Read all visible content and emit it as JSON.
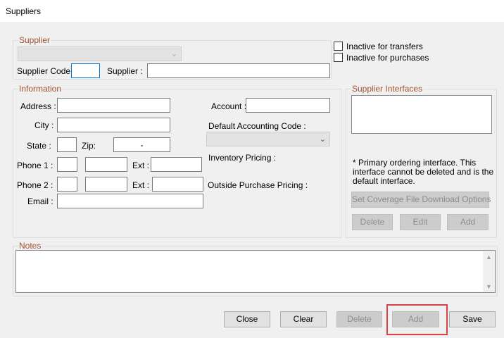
{
  "window": {
    "title": "Suppliers"
  },
  "supplier_group": {
    "title": "Supplier",
    "supplier_code_label": "Supplier Code :",
    "supplier_code_value": "",
    "supplier_label": "Supplier :",
    "supplier_value": ""
  },
  "flags": {
    "inactive_transfers_label": "Inactive for transfers",
    "inactive_purchases_label": "Inactive for purchases"
  },
  "information": {
    "title": "Information",
    "address_label": "Address :",
    "city_label": "City :",
    "state_label": "State :",
    "zip_label": "Zip:",
    "zip_value": "-",
    "phone1_label": "Phone 1 :",
    "phone2_label": "Phone 2 :",
    "ext_label": "Ext :",
    "email_label": "Email :",
    "account_label": "Account :",
    "default_accounting_code_label": "Default Accounting Code :",
    "inventory_pricing_label": "Inventory Pricing :",
    "outside_purchase_pricing_label": "Outside Purchase Pricing :"
  },
  "interfaces": {
    "title": "Supplier Interfaces",
    "note_line1": "* Primary ordering interface.  This",
    "note_line2": "interface cannot be deleted and is the",
    "note_line3": "default interface.",
    "coverage_button": "Set Coverage File Download Options",
    "delete_button": "Delete",
    "edit_button": "Edit",
    "add_button": "Add"
  },
  "notes": {
    "title": "Notes",
    "value": ""
  },
  "footer": {
    "close": "Close",
    "clear": "Clear",
    "delete": "Delete",
    "add": "Add",
    "save": "Save"
  },
  "colors": {
    "group_title": "#a0522d",
    "focus_border": "#0078d7",
    "highlight": "#d9424a"
  }
}
